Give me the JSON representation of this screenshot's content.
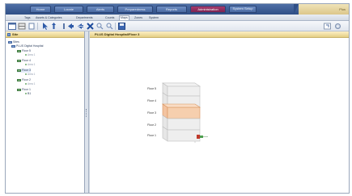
{
  "app": {
    "top_tabs": [
      "Home",
      "Locate",
      "Alerts",
      "Preparedness",
      "Reports",
      "Administration",
      "System Setup"
    ],
    "active_top_tab": "Administration",
    "top_right_label": "Plus"
  },
  "subnav": {
    "items": [
      "Tags",
      "Assets & Categories",
      "Departments",
      "Counts",
      "Maps",
      "Zones",
      "System"
    ],
    "active": "Maps"
  },
  "toolbar": {
    "icons": [
      "map-icon",
      "floors-icon",
      "select-icon",
      "cursor-icon",
      "rotate-icon",
      "prev-icon",
      "next-icon",
      "delete-icon",
      "zoom-in-icon",
      "zoom-out-icon",
      "save-icon",
      "expand-icon",
      "settings-icon"
    ]
  },
  "left_panel": {
    "title": "Site",
    "tree": [
      {
        "label": "Sites",
        "indent": 0,
        "type": "folder"
      },
      {
        "label": "PLUS Digital Hospital",
        "indent": 1,
        "type": "building"
      },
      {
        "label": "Floor 5",
        "indent": 2,
        "type": "floor"
      },
      {
        "label": "Area 1",
        "indent": 3,
        "type": "leaf"
      },
      {
        "label": "Floor 4",
        "indent": 2,
        "type": "floor"
      },
      {
        "label": "Area 1",
        "indent": 3,
        "type": "leaf"
      },
      {
        "label": "Floor 3",
        "indent": 2,
        "type": "floor"
      },
      {
        "label": "Area 1",
        "indent": 3,
        "type": "leaf"
      },
      {
        "label": "Floor 2",
        "indent": 2,
        "type": "floor"
      },
      {
        "label": "Area 1",
        "indent": 3,
        "type": "leaf"
      },
      {
        "label": "Floor 1",
        "indent": 2,
        "type": "floor"
      },
      {
        "label": "B1",
        "indent": 3,
        "type": "leaf"
      }
    ]
  },
  "main": {
    "title": "PLUS Digital Hospital/Floor 3",
    "floors": [
      "Floor 5",
      "Floor 4",
      "Floor 3",
      "Floor 2",
      "Floor 1"
    ],
    "selected_floor": "Floor 3"
  },
  "colors": {
    "topbar": "#2f4f86",
    "active_tab": "#7c2453",
    "panel_header": "#e5cf84",
    "selected_floor": "#eab08a",
    "marker": "#c0392b"
  }
}
